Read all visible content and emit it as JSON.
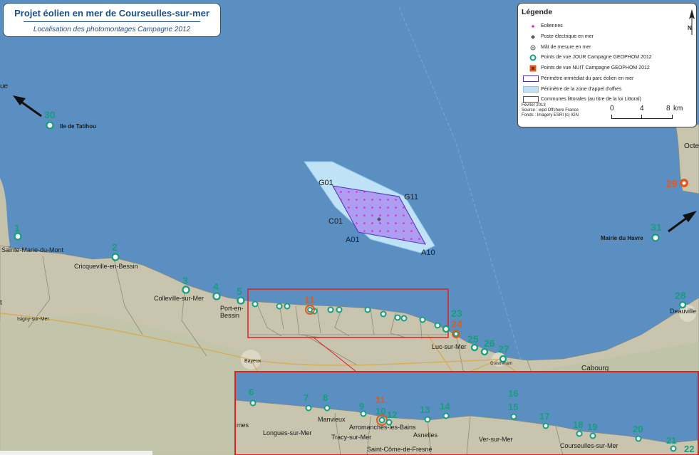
{
  "title": {
    "main": "Projet éolien en mer de Courseulles-sur-mer",
    "sub": "Localisation des photomontages Campagne 2012"
  },
  "legend": {
    "heading": "Légende",
    "items": [
      {
        "label": "Eoliennes",
        "symbol": "magenta-dot"
      },
      {
        "label": "Poste électrique en mer",
        "symbol": "grey-diamond"
      },
      {
        "label": "Mât de mesure en mer",
        "symbol": "grey-circle"
      },
      {
        "label": "Points de vue JOUR Campagne GEOPHOM 2012",
        "symbol": "green-ring"
      },
      {
        "label": "Points de vue NUIT Campagne GEOPHOM 2012",
        "symbol": "orange-square"
      },
      {
        "label": "Périmètre immédiat du parc éolien en mer",
        "symbol": "outline-box"
      },
      {
        "label": "Périmètre de la zone d'appel d'offres",
        "symbol": "lightblue-box"
      },
      {
        "label": "Communes littorales (au titre de la loi Littoral)",
        "symbol": "white-box"
      }
    ],
    "source": [
      "Février 2013",
      "Source : wpd Offshore France",
      "Fonds : Imagery ESRI (c) IGN"
    ],
    "scale": {
      "ticks": [
        "0",
        "4",
        "8"
      ],
      "unit": "km"
    },
    "north_label": "N"
  },
  "colors": {
    "sea": "#5b8fc2",
    "land": "#c7c3ad",
    "green": "#159f7c",
    "orange": "#e05a1e",
    "turbine": "#d92bd9",
    "zone": "#bfe2f6",
    "inset_frame": "#e02020"
  },
  "farm_labels": {
    "g01": "G01",
    "g11": "G11",
    "c01": "C01",
    "a01": "A01",
    "a10": "A10"
  },
  "main_viewpoints": [
    {
      "num": "1",
      "place": "Sainte-Marie-du-Mont"
    },
    {
      "num": "2",
      "place": "Cricqueville-en-Bessin"
    },
    {
      "num": "3",
      "place": "Colleville-sur-Mer"
    },
    {
      "num": "4",
      "place": ""
    },
    {
      "num": "5",
      "place": "Port-en-Bessin"
    },
    {
      "num": "11",
      "place": ""
    },
    {
      "num": "23",
      "place": ""
    },
    {
      "num": "24",
      "place": "Luc-sur-Mer"
    },
    {
      "num": "25",
      "place": ""
    },
    {
      "num": "26",
      "place": ""
    },
    {
      "num": "27",
      "place": "Ouistreham"
    },
    {
      "num": "28",
      "place": "Deauville"
    },
    {
      "num": "29",
      "place": ""
    },
    {
      "num": "30",
      "place": "Ile de Tatihou"
    },
    {
      "num": "31",
      "place": "Mairie du Havre"
    }
  ],
  "map_towns": [
    "Cabourg",
    "Bayeux",
    "Isigny-sur-Mer",
    "Octe"
  ],
  "inset": {
    "points": [
      "6",
      "7",
      "8",
      "9",
      "10",
      "11",
      "12",
      "13",
      "14",
      "15",
      "16",
      "17",
      "18",
      "19",
      "20",
      "21",
      "22"
    ],
    "towns": [
      "Longues-sur-Mer",
      "Manvieux",
      "Arromanches-les-Bains",
      "Tracy-sur-Mer",
      "Asnelles",
      "Ver-sur-Mer",
      "Courseulles-sur-Mer",
      "Saint-Côme-de-Fresné",
      "mes"
    ]
  }
}
